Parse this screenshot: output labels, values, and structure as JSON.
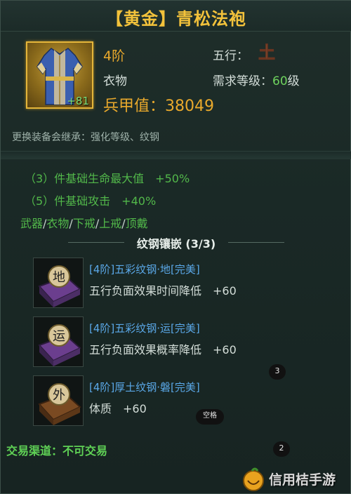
{
  "title": "【黄金】青松法袍",
  "item": {
    "icon": "robe-icon",
    "bonus": "+81",
    "tier": "4阶",
    "slot": "衣物",
    "armor_label": "兵甲值：38049",
    "element_label": "五行：",
    "element": "土",
    "req_level_label": "需求等级：",
    "req_level": "60",
    "req_level_suffix": "级"
  },
  "inherit_text": "更换装备会继承：强化等级、纹钢",
  "set": {
    "bonuses": [
      "（3）件基础生命最大值　+50%",
      "（5）件基础攻击　+40%"
    ],
    "pieces": [
      "武器",
      "衣物",
      "下戒",
      "上戒",
      "顶戴"
    ],
    "separator": "/"
  },
  "gems": {
    "header": "纹钢镶嵌 (3/3)",
    "items": [
      {
        "glyph": "地",
        "name": "[4阶]五彩纹钢·地[完美]",
        "effect": "五行负面效果时间降低　+60",
        "color": "#6b3e8e"
      },
      {
        "glyph": "运",
        "name": "[4阶]五彩纹钢·运[完美]",
        "effect": "五行负面效果概率降低　+60",
        "color": "#6b3e8e"
      },
      {
        "glyph": "外",
        "name": "[4阶]厚土纹钢·磐[完美]",
        "effect": "体质　+60",
        "color": "#7a4a22"
      }
    ]
  },
  "badges": {
    "b3": "3",
    "space": "空格",
    "b2": "2"
  },
  "trade_text": "交易渠道：不可交易",
  "watermark": "信用桔手游",
  "colors": {
    "gold": "#f3c23b",
    "orange": "#e9a92c",
    "green": "#52b84a",
    "blue": "#5aa8e8"
  }
}
